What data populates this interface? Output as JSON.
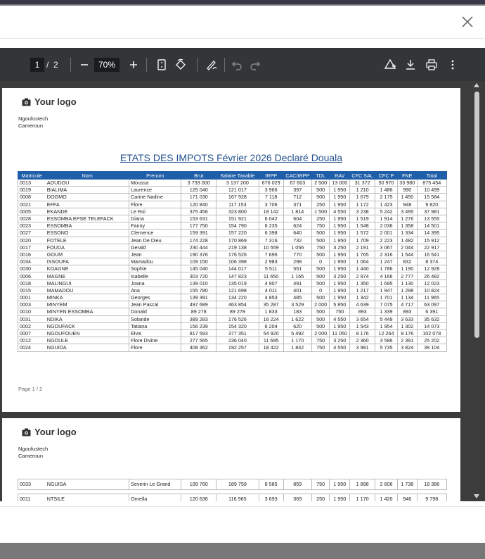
{
  "toolbar": {
    "current_page": "1",
    "separator": "/",
    "total_pages": "2",
    "zoom": "70%"
  },
  "icons": {
    "close": "close-icon",
    "zoom_out": "minus-icon",
    "zoom_in": "plus-icon",
    "fit": "fit-page-icon",
    "rotate": "rotate-icon",
    "annotate": "draw-icon",
    "undo": "undo-icon",
    "redo": "redo-icon",
    "annotate_pdf": "annotate-pdf-icon",
    "download": "download-icon",
    "print": "print-icon",
    "more": "more-vert-icon"
  },
  "colors": {
    "header_blue": "#1f5ea8",
    "title_blue": "#1f4e8a"
  },
  "page1": {
    "logo": "Your logo",
    "company_name": "Ngoufustech",
    "company_country": "Cameroun",
    "title": "ETATS DES IMPOTS Février 2026 Declaré Douala",
    "footer": "Page 1 / 2",
    "headers": [
      "Matricule",
      "Nom",
      "Prenom",
      "Brut",
      "Salaire Taxable",
      "IRPP",
      "CAC/IRPP",
      "TDL",
      "RAV",
      "CFC SAL",
      "CFC P",
      "FNE",
      "Total"
    ],
    "rows": [
      [
        "0013",
        "AOUDOU",
        "Moussa",
        "3 733 000",
        "3 137 200",
        "676 029",
        "67 603",
        "2 500",
        "13 000",
        "31 372",
        "50 970",
        "33 980",
        "875 454"
      ],
      [
        "0019",
        "BIALIMA",
        "Laurence",
        "125 040",
        "121 017",
        "3 966",
        "397",
        "500",
        "1 950",
        "1 210",
        "1 486",
        "990",
        "10 499"
      ],
      [
        "0008",
        "DOGMO",
        "Carine Nadine",
        "171 030",
        "167 928",
        "7 118",
        "712",
        "500",
        "1 950",
        "1 679",
        "2 175",
        "1 450",
        "15 584"
      ],
      [
        "0021",
        "EFFA",
        "Flore",
        "120 840",
        "117 153",
        "3 706",
        "371",
        "250",
        "1 950",
        "1 172",
        "1 423",
        "948",
        "9 820"
      ],
      [
        "0005",
        "EKANDE",
        "Le Roi",
        "375 456",
        "323 800",
        "18 142",
        "1 814",
        "1 500",
        "4 550",
        "3 238",
        "5 242",
        "3 495",
        "37 981"
      ],
      [
        "0028",
        "ESSOMBA EPSE TELEFACK",
        "Diana",
        "153 631",
        "151 921",
        "6 042",
        "604",
        "250",
        "1 950",
        "1 519",
        "1 914",
        "1 276",
        "13 555"
      ],
      [
        "0023",
        "ESSOMBA",
        "Fanny",
        "177 750",
        "154 790",
        "6 235",
        "624",
        "750",
        "1 950",
        "1 548",
        "2 036",
        "1 358",
        "14 501"
      ],
      [
        "0027",
        "ESSONO",
        "Clemence",
        "159 391",
        "157 220",
        "6 398",
        "640",
        "500",
        "1 950",
        "1 572",
        "2 001",
        "1 334",
        "14 395"
      ],
      [
        "0020",
        "FOTELE",
        "Jean De Dieu",
        "174 228",
        "170 869",
        "7 316",
        "732",
        "500",
        "1 950",
        "1 709",
        "2 223",
        "1 482",
        "15 912"
      ],
      [
        "0017",
        "FOUDA",
        "Gerald",
        "230 444",
        "219 138",
        "10 559",
        "1 056",
        "750",
        "3 250",
        "2 191",
        "3 067",
        "2 044",
        "22 917"
      ],
      [
        "0016",
        "GOUM",
        "Jean",
        "190 376",
        "176 526",
        "7 696",
        "770",
        "500",
        "1 950",
        "1 765",
        "2 316",
        "1 544",
        "16 541"
      ],
      [
        "0034",
        "ISSOUFA",
        "Mamadou",
        "109 150",
        "106 398",
        "2 983",
        "298",
        "0",
        "1 950",
        "1 064",
        "1 247",
        "832",
        "8 374"
      ],
      [
        "0030",
        "KOAGNE",
        "Sophie",
        "145 040",
        "144 017",
        "5 511",
        "551",
        "500",
        "1 950",
        "1 440",
        "1 786",
        "1 190",
        "12 928"
      ],
      [
        "0006",
        "MAGNE",
        "Isabelle",
        "303 720",
        "147 823",
        "11 650",
        "1 165",
        "500",
        "3 250",
        "2 974",
        "4 166",
        "2 777",
        "26 482"
      ],
      [
        "0018",
        "MALINGUI",
        "Joana",
        "139 010",
        "135 019",
        "4 907",
        "491",
        "500",
        "1 950",
        "1 350",
        "1 695",
        "1 130",
        "12 023"
      ],
      [
        "0015",
        "MAMADOU",
        "Ana",
        "155 780",
        "121 698",
        "4 011",
        "401",
        "0",
        "1 950",
        "1 217",
        "1 947",
        "1 298",
        "10 824"
      ],
      [
        "0001",
        "MINKA",
        "Georges",
        "139 391",
        "134 220",
        "4 853",
        "485",
        "500",
        "1 950",
        "1 342",
        "1 701",
        "1 134",
        "11 965"
      ],
      [
        "0003",
        "MINYEM",
        "Jean Pascal",
        "497 689",
        "463 854",
        "35 287",
        "3 529",
        "2 000",
        "5 850",
        "4 639",
        "7 075",
        "4 717",
        "63 097"
      ],
      [
        "0010",
        "MINYEN ESSOMBA",
        "Donald",
        "89 278",
        "89 278",
        "1 833",
        "183",
        "500",
        "750",
        "893",
        "1 339",
        "893",
        "6 391"
      ],
      [
        "0031",
        "NDIKA",
        "Solande",
        "389 283",
        "176 526",
        "16 224",
        "1 622",
        "500",
        "4 550",
        "3 654",
        "5 449",
        "3 633",
        "35 632"
      ],
      [
        "0002",
        "NGOUFACK",
        "Tatiana",
        "156 239",
        "154 320",
        "6 204",
        "620",
        "500",
        "1 950",
        "1 543",
        "1 954",
        "1 302",
        "14 073"
      ],
      [
        "0007",
        "NGOUFOUEN",
        "Elvis",
        "817 593",
        "377 351",
        "54 920",
        "5 492",
        "2 000",
        "11 050",
        "8 176",
        "12 264",
        "8 176",
        "102 078"
      ],
      [
        "0012",
        "NGOULE",
        "Flore Divine",
        "277 565",
        "236 040",
        "11 695",
        "1 170",
        "750",
        "3 250",
        "2 360",
        "3 586",
        "2 391",
        "25 202"
      ],
      [
        "0024",
        "NGUIDA",
        "Flore",
        "408 362",
        "192 257",
        "18 422",
        "1 842",
        "750",
        "4 550",
        "3 981",
        "5 735",
        "3 824",
        "39 104"
      ]
    ]
  },
  "page2": {
    "logo": "Your logo",
    "company_name": "Ngoufustech",
    "company_country": "Cameroun",
    "rows": [
      [
        "0033",
        "NGUISA",
        "Severin Le Grand",
        "199 760",
        "189 759",
        "8 585",
        "859",
        "750",
        "1 950",
        "1 898",
        "2 606",
        "1 738",
        "18 386"
      ],
      [
        "0011",
        "NTSILE",
        "Ornella",
        "120 636",
        "116 965",
        "3 693",
        "369",
        "250",
        "1 950",
        "1 170",
        "1 420",
        "946",
        "9 798"
      ]
    ]
  }
}
